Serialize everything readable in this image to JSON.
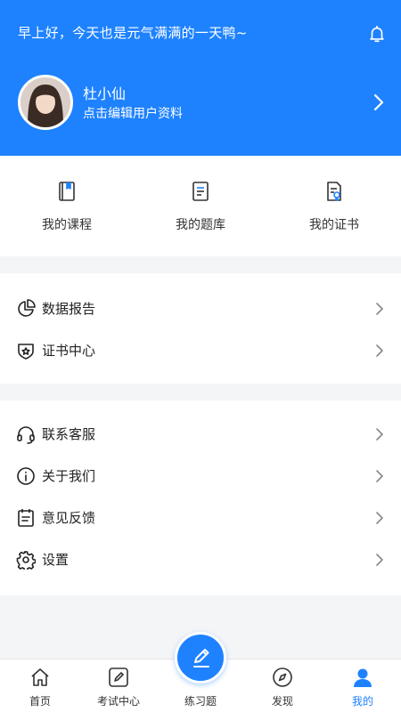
{
  "header": {
    "greeting": "早上好，今天也是元气满满的一天鸭~",
    "username": "杜小仙",
    "profile_link": "点击编辑用户资料",
    "bell_icon": "bell-icon",
    "chevron_icon": "chevron-right-icon"
  },
  "quick_actions": [
    {
      "label": "我的课程",
      "icon": "bookmark-book-icon"
    },
    {
      "label": "我的题库",
      "icon": "question-bank-icon"
    },
    {
      "label": "我的证书",
      "icon": "certificate-doc-icon"
    }
  ],
  "menu_group_1": [
    {
      "label": "数据报告",
      "icon": "pie-chart-icon"
    },
    {
      "label": "证书中心",
      "icon": "shield-star-icon"
    }
  ],
  "menu_group_2": [
    {
      "label": "联系客服",
      "icon": "headset-icon"
    },
    {
      "label": "关于我们",
      "icon": "info-icon"
    },
    {
      "label": "意见反馈",
      "icon": "feedback-icon"
    },
    {
      "label": "设置",
      "icon": "gear-icon"
    }
  ],
  "tabbar": {
    "tabs": [
      {
        "label": "首页",
        "icon": "home-icon"
      },
      {
        "label": "考试中心",
        "icon": "exam-pen-icon"
      },
      {
        "label": "练习题",
        "icon": "pencil-icon"
      },
      {
        "label": "发现",
        "icon": "compass-icon"
      },
      {
        "label": "我的",
        "icon": "user-icon"
      }
    ],
    "active_index": 4
  },
  "colors": {
    "accent": "#1e82ff",
    "background": "#f4f5f7"
  }
}
